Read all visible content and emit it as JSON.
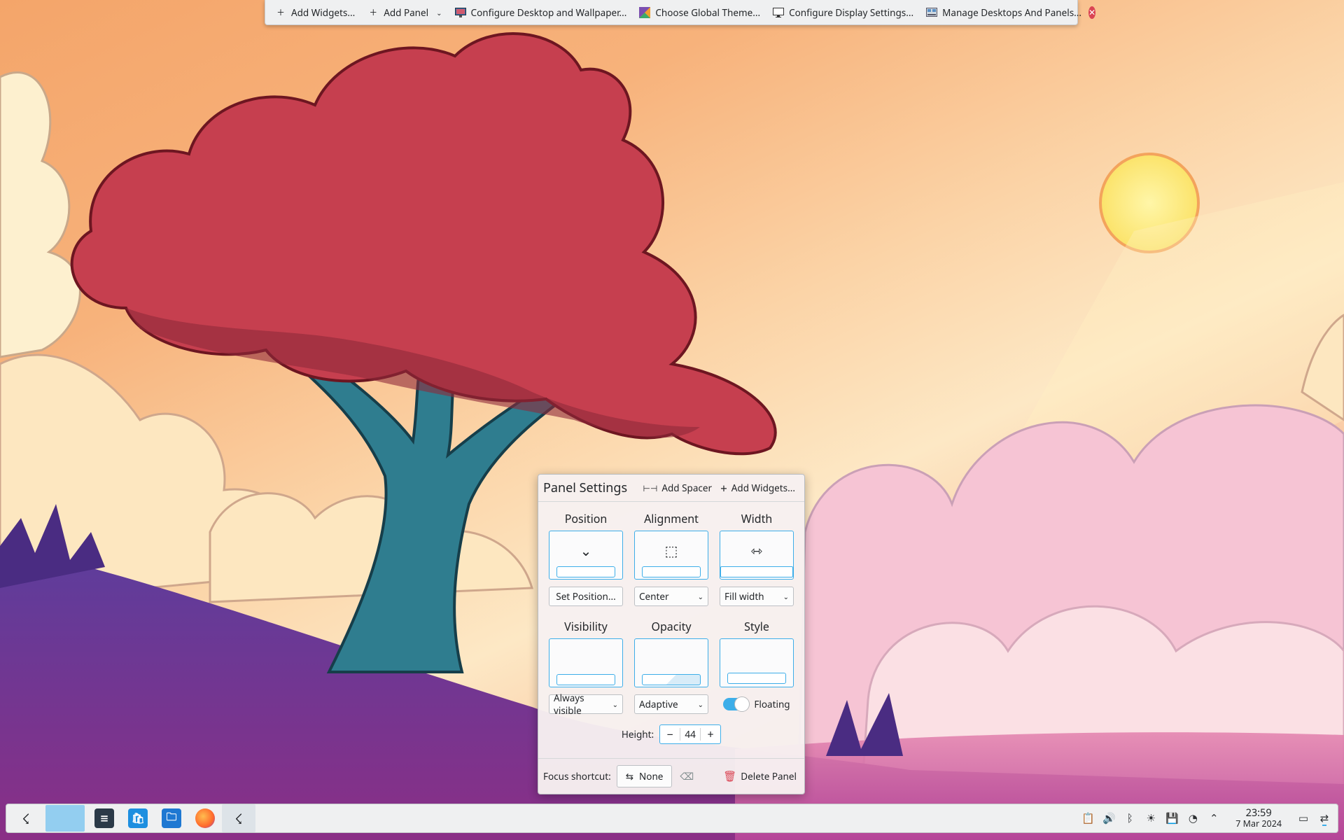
{
  "toolbar": {
    "add_widgets": "Add Widgets...",
    "add_panel": "Add Panel",
    "configure_desktop": "Configure Desktop and Wallpaper...",
    "choose_theme": "Choose Global Theme...",
    "configure_display": "Configure Display Settings...",
    "manage_desktops": "Manage Desktops And Panels..."
  },
  "panel_settings": {
    "title": "Panel Settings",
    "add_spacer": "Add Spacer",
    "add_widgets": "Add Widgets...",
    "position": {
      "label": "Position",
      "button": "Set Position..."
    },
    "alignment": {
      "label": "Alignment",
      "value": "Center"
    },
    "width": {
      "label": "Width",
      "value": "Fill width"
    },
    "visibility": {
      "label": "Visibility",
      "value": "Always visible"
    },
    "opacity": {
      "label": "Opacity",
      "value": "Adaptive"
    },
    "style": {
      "label": "Style",
      "toggle_label": "Floating",
      "floating": true
    },
    "height": {
      "label": "Height:",
      "value": "44"
    },
    "focus_shortcut": {
      "label": "Focus shortcut:",
      "value": "None"
    },
    "delete_panel": "Delete Panel"
  },
  "taskbar": {
    "clock_time": "23:59",
    "clock_date": "7 Mar 2024"
  },
  "colors": {
    "accent": "#3daee9",
    "danger": "#da4453",
    "panel_bg": "#eff0f1"
  }
}
